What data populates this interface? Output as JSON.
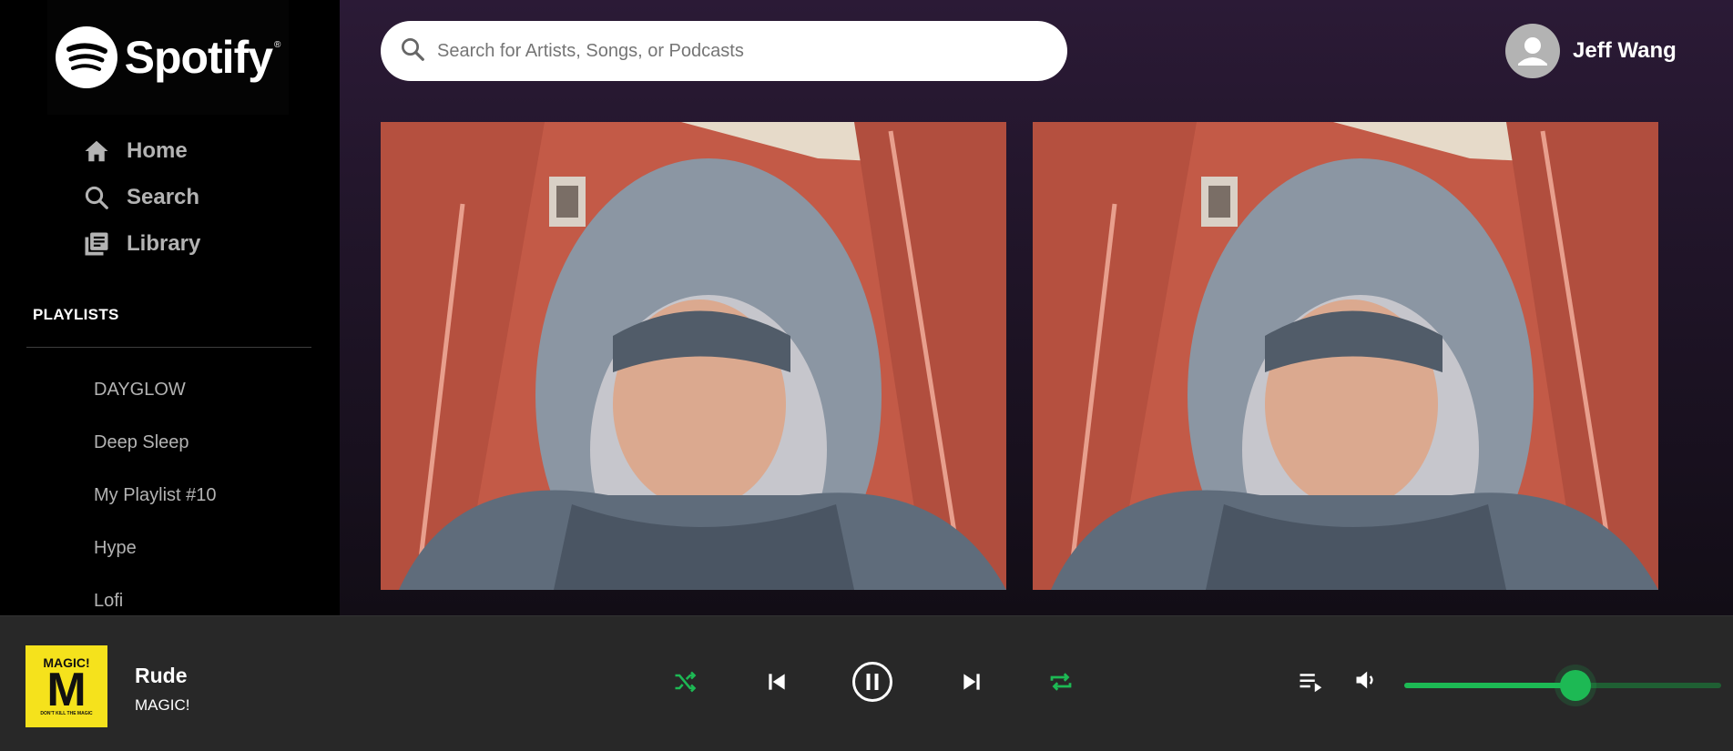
{
  "brand": {
    "name": "Spotify",
    "reg": "®",
    "accent": "#1db954"
  },
  "nav": [
    {
      "label": "Home",
      "icon": "home-icon"
    },
    {
      "label": "Search",
      "icon": "search-icon"
    },
    {
      "label": "Library",
      "icon": "library-icon"
    }
  ],
  "playlists": {
    "title": "PLAYLISTS",
    "items": [
      "DAYGLOW",
      "Deep Sleep",
      "My Playlist #10",
      "Hype",
      "Lofi"
    ]
  },
  "search": {
    "placeholder": "Search for Artists, Songs, or Podcasts"
  },
  "user": {
    "name": "Jeff Wang"
  },
  "now_playing": {
    "title": "Rude",
    "artist": "MAGIC!",
    "album_art_text": "MAGIC!",
    "album_art_letter": "M",
    "album_art_tagline": "DON'T KILL THE MAGIC",
    "album_art_color": "#f5e21c",
    "shuffle_active": true,
    "repeat_active": true,
    "is_playing": true
  },
  "volume": {
    "level": 0.54
  }
}
